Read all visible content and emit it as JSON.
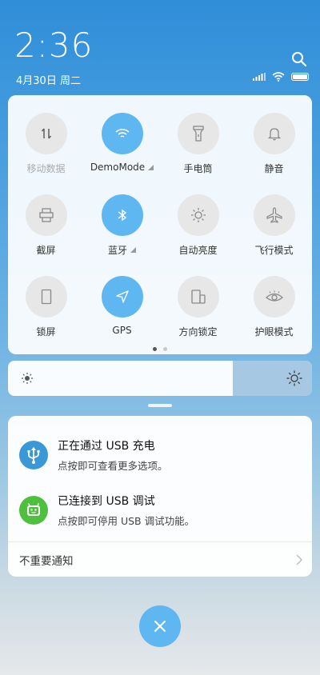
{
  "status": {
    "time": "2:36",
    "date": "4月30日 周二"
  },
  "header_icons": [
    "search-icon",
    "signal-icon",
    "wifi-icon",
    "battery-icon"
  ],
  "quick_toggles": [
    {
      "label": "移动数据",
      "icon": "mobile-data-icon",
      "active": false
    },
    {
      "label": "DemoMode",
      "icon": "wifi-icon",
      "active": true
    },
    {
      "label": "手电筒",
      "icon": "flashlight-icon",
      "active": false
    },
    {
      "label": "静音",
      "icon": "bell-icon",
      "active": false
    },
    {
      "label": "截屏",
      "icon": "screenshot-icon",
      "active": false
    },
    {
      "label": "蓝牙",
      "icon": "bluetooth-icon",
      "active": true
    },
    {
      "label": "自动亮度",
      "icon": "auto-brightness-icon",
      "active": false
    },
    {
      "label": "飞行模式",
      "icon": "airplane-icon",
      "active": false
    },
    {
      "label": "锁屏",
      "icon": "lock-screen-icon",
      "active": false
    },
    {
      "label": "GPS",
      "icon": "location-icon",
      "active": true
    },
    {
      "label": "方向锁定",
      "icon": "rotation-lock-icon",
      "active": false
    },
    {
      "label": "护眼模式",
      "icon": "eye-icon",
      "active": false
    }
  ],
  "page_indicator": {
    "pages": 2,
    "current": 1
  },
  "brightness": {
    "level_percent": 74
  },
  "notifications": [
    {
      "title": "正在通过 USB 充电",
      "subtitle": "点按即可查看更多选项。",
      "icon": "usb-icon",
      "color": "#3a98d6"
    },
    {
      "title": "已连接到 USB 调试",
      "subtitle": "点按即可停用 USB 调试功能。",
      "icon": "android-icon",
      "color": "#4fbf3f"
    }
  ],
  "unimportant_label": "不重要通知",
  "colors": {
    "accent": "#5fb7f2",
    "tile_off": "#e7e7e7"
  }
}
